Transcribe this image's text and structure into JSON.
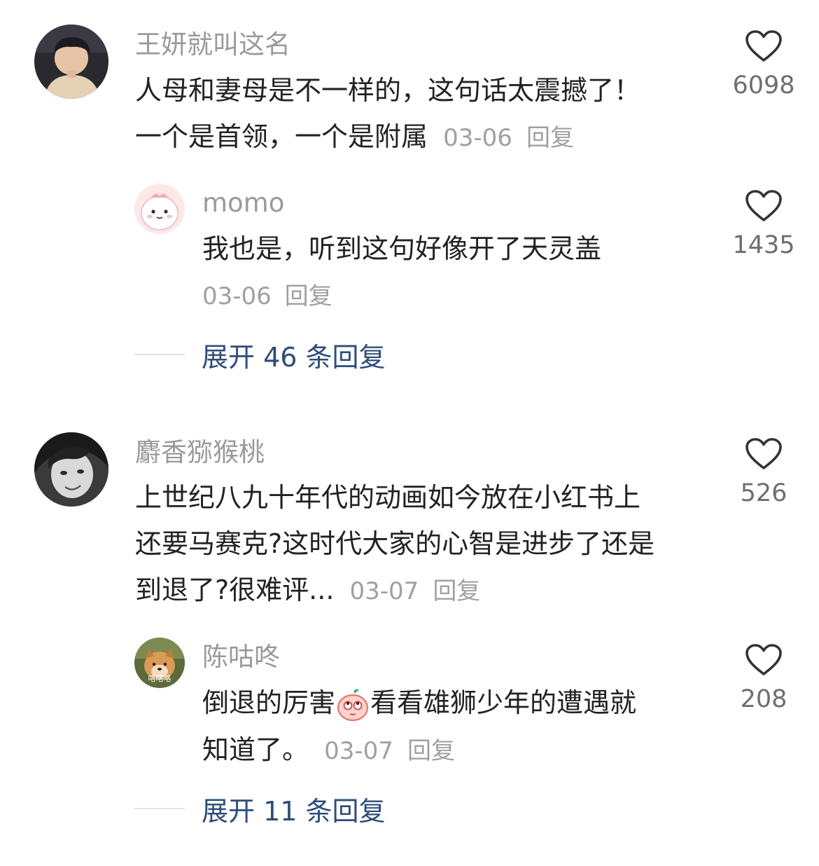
{
  "comments": [
    {
      "author": "王妍就叫这名",
      "lines": [
        "人母和妻母是不一样的，这句话太震撼了！",
        "一个是首领，一个是附属"
      ],
      "date": "03-06",
      "reply_label": "回复",
      "likes": "6098",
      "reply": {
        "author": "momo",
        "lines": [
          "我也是，听到这句好像开了天灵盖"
        ],
        "date": "03-06",
        "reply_label": "回复",
        "likes": "1435"
      },
      "expand_label": "展开 46 条回复"
    },
    {
      "author": "麝香猕猴桃",
      "lines": [
        "上世纪八九十年代的动画如今放在小红书上",
        "还要马赛克?这时代大家的心智是进步了还是",
        "到退了?很难评..."
      ],
      "date": "03-07",
      "reply_label": "回复",
      "likes": "526",
      "reply": {
        "author": "陈咕咚",
        "line1_a": "倒退的厉害",
        "line1_b": "看看雄狮少年的遭遇就",
        "line2": "知道了。",
        "date": "03-07",
        "reply_label": "回复",
        "likes": "208",
        "avatar_caption": "咯咯咯"
      },
      "expand_label": "展开 11 条回复"
    }
  ],
  "icons": {
    "like": "heart-outline-icon",
    "emoji": "peach-eyes-up-emoji"
  },
  "colors": {
    "author": "#9a9a9a",
    "meta": "#a0a0a0",
    "expand": "#2e4d79"
  }
}
